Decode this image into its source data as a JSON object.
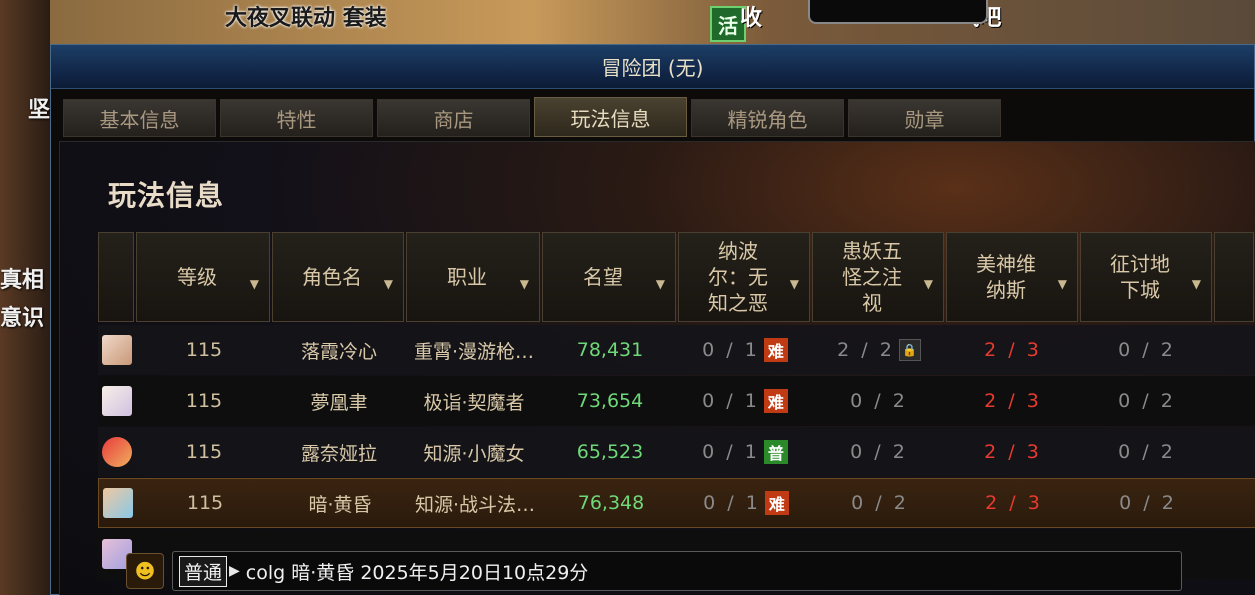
{
  "background": {
    "promo_left": "大夜叉联动 套装",
    "promo_right": "收",
    "promo_right2": "气吧",
    "side_text_1": "坚",
    "side_text_2": "真相",
    "side_text_3": "意识",
    "badge": "活"
  },
  "window": {
    "title": "冒险团 (无)"
  },
  "tabs": [
    {
      "label": "基本信息",
      "active": false
    },
    {
      "label": "特性",
      "active": false
    },
    {
      "label": "商店",
      "active": false
    },
    {
      "label": "玩法信息",
      "active": true
    },
    {
      "label": "精锐角色",
      "active": false
    },
    {
      "label": "勋章",
      "active": false
    }
  ],
  "panel": {
    "title": "玩法信息"
  },
  "table": {
    "headers": {
      "level": "等级",
      "name": "角色名",
      "job": "职业",
      "fame": "名望",
      "d1": "纳波尔：无知之恶",
      "d2": "患妖五怪之注视",
      "d3": "美神维纳斯",
      "d4": "征讨地下城"
    },
    "rows": [
      {
        "level": "115",
        "name": "落霞冷心",
        "job": "重霄·漫游枪…",
        "fame": "78,431",
        "d1": "0 / 1",
        "d1_badge": "难",
        "d2": "2 / 2",
        "d3": "2 / 3",
        "d4": "0 / 2"
      },
      {
        "level": "115",
        "name": "夢凰聿",
        "job": "极诣·契魔者",
        "fame": "73,654",
        "d1": "0 / 1",
        "d1_badge": "难",
        "d2": "0 / 2",
        "d3": "2 / 3",
        "d4": "0 / 2"
      },
      {
        "level": "115",
        "name": "露奈娅拉",
        "job": "知源·小魔女",
        "fame": "65,523",
        "d1": "0 / 1",
        "d1_badge": "普",
        "d2": "0 / 2",
        "d3": "2 / 3",
        "d4": "0 / 2"
      },
      {
        "level": "115",
        "name": "暗·黄昏",
        "job": "知源·战斗法…",
        "fame": "76,348",
        "d1": "0 / 1",
        "d1_badge": "难",
        "d2": "0 / 2",
        "d3": "2 / 3",
        "d4": "0 / 2"
      }
    ]
  },
  "chat": {
    "channel": "普通",
    "message": "colg 暗·黄昏 2025年5月20日10点29分"
  },
  "colors": {
    "fame": "#6fd878",
    "count_red": "#e83a30",
    "badge_hard": "#c03a14",
    "badge_normal": "#2a8a2a",
    "title_bar": "#1c3e66"
  }
}
